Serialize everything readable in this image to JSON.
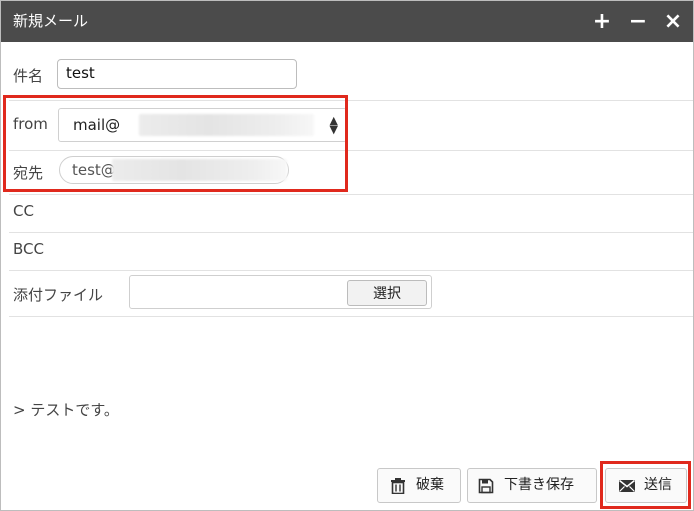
{
  "window": {
    "title": "新規メール",
    "controls": {
      "add": "+",
      "minimize": "−",
      "close": "×"
    }
  },
  "form": {
    "subject": {
      "label": "件名",
      "value": "test"
    },
    "from": {
      "label": "from",
      "value": "mail@"
    },
    "to": {
      "label": "宛先",
      "chip": "test@"
    },
    "cc": {
      "label": "CC"
    },
    "bcc": {
      "label": "BCC"
    },
    "attachment": {
      "label": "添付ファイル",
      "button": "選択"
    }
  },
  "body": {
    "text": "> テストです。"
  },
  "footer": {
    "discard": "破棄",
    "save_draft": "下書き保存",
    "send": "送信"
  },
  "colors": {
    "titlebar": "#4b4b4b",
    "highlight": "#e0291d"
  }
}
